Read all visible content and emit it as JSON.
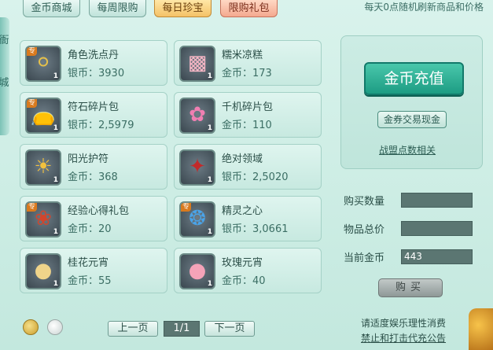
{
  "tabs": [
    {
      "label": "金币商城"
    },
    {
      "label": "每周限购"
    },
    {
      "label": "每日珍宝"
    },
    {
      "label": "限购礼包"
    }
  ],
  "notice": "每天0点随机刷新商品和价格",
  "side_labels": [
    "衙",
    "城"
  ],
  "items": [
    {
      "name": "角色洗点丹",
      "price": "银币：3930",
      "qty": "1",
      "tag": "专",
      "icon": "pill-icon",
      "glyph": "⚪"
    },
    {
      "name": "糯米凉糕",
      "price": "金币：173",
      "qty": "1",
      "tag": "",
      "icon": "rice-cake-icon",
      "glyph": "▩"
    },
    {
      "name": "符石碎片包",
      "price": "银币：2,5979",
      "qty": "1",
      "tag": "专",
      "icon": "rune-pouch-icon",
      "glyph": "👝"
    },
    {
      "name": "千机碎片包",
      "price": "金币：110",
      "qty": "1",
      "tag": "",
      "icon": "lotus-pouch-icon",
      "glyph": "✿"
    },
    {
      "name": "阳光护符",
      "price": "金币：368",
      "qty": "1",
      "tag": "",
      "icon": "sun-amulet-icon",
      "glyph": "☀"
    },
    {
      "name": "绝对领域",
      "price": "银币：2,5020",
      "qty": "1",
      "tag": "",
      "icon": "domain-icon",
      "glyph": "✦"
    },
    {
      "name": "经验心得礼包",
      "price": "金币：20",
      "qty": "1",
      "tag": "专",
      "icon": "exp-pouch-icon",
      "glyph": "❀"
    },
    {
      "name": "精灵之心",
      "price": "银币：3,0661",
      "qty": "1",
      "tag": "专",
      "icon": "spirit-heart-icon",
      "glyph": "❂"
    },
    {
      "name": "桂花元宵",
      "price": "金币：55",
      "qty": "1",
      "tag": "",
      "icon": "osmanthus-dumpling-icon",
      "glyph": "●"
    },
    {
      "name": "玫瑰元宵",
      "price": "金币：40",
      "qty": "1",
      "tag": "",
      "icon": "rose-dumpling-icon",
      "glyph": "●"
    }
  ],
  "panel": {
    "recharge": "金币充值",
    "exchange": "金券交易现金",
    "alliance": "战盟点数相关",
    "buy_qty_label": "购买数量",
    "buy_qty_value": "",
    "total_label": "物品总价",
    "total_value": "",
    "gold_label": "当前金币",
    "gold_value": "443",
    "buy": "购买"
  },
  "pager": {
    "prev": "上一页",
    "page": "1/1",
    "next": "下一页"
  },
  "footer": {
    "line1": "请适度娱乐理性消费",
    "line2": "禁止和打击代充公告"
  },
  "colors": {
    "active_tab": "#f4c267",
    "promo_tab": "#f4a98f",
    "recharge": "#1d9c83"
  }
}
